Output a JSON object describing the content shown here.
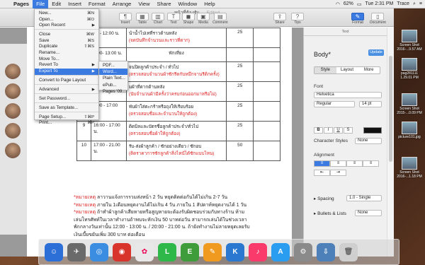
{
  "menubar": {
    "app_name": "Pages",
    "items": [
      "File",
      "Edit",
      "Insert",
      "Format",
      "Arrange",
      "View",
      "Share",
      "Window",
      "Help"
    ],
    "battery": "62%",
    "clock": "Tue 2:31 PM",
    "user": "Trace"
  },
  "window": {
    "title": "หน้าที่ต้องรับ",
    "edited": "— Edited",
    "toolbar": {
      "insert": "Insert",
      "table": "Table",
      "chart": "Chart",
      "text": "Text",
      "shape": "Shape",
      "media": "Media",
      "comment": "Comment",
      "share": "Share",
      "tips": "Tips",
      "format": "Format",
      "document": "Document"
    }
  },
  "file_menu": {
    "items": [
      {
        "label": "New...",
        "shortcut": "⌘N"
      },
      {
        "label": "Open...",
        "shortcut": "⌘O"
      },
      {
        "label": "Open Recent",
        "shortcut": "▶"
      },
      {
        "label": "Close",
        "shortcut": "⌘W"
      },
      {
        "label": "Save",
        "shortcut": "⌘S"
      },
      {
        "label": "Duplicate",
        "shortcut": "⇧⌘S"
      },
      {
        "label": "Rename...",
        "shortcut": ""
      },
      {
        "label": "Move To...",
        "shortcut": ""
      },
      {
        "label": "Revert To",
        "shortcut": "▶"
      },
      {
        "label": "Export To",
        "shortcut": "▶"
      },
      {
        "label": "Convert to Page Layout",
        "shortcut": ""
      },
      {
        "label": "Advanced",
        "shortcut": "▶"
      },
      {
        "label": "Set Password...",
        "shortcut": ""
      },
      {
        "label": "Save as Template...",
        "shortcut": ""
      },
      {
        "label": "Page Setup...",
        "shortcut": "⇧⌘P"
      },
      {
        "label": "Print...",
        "shortcut": "⌘P"
      }
    ]
  },
  "export_submenu": {
    "items": [
      "PDF...",
      "Word...",
      "Plain Text...",
      "ePub...",
      "Pages '09..."
    ]
  },
  "document": {
    "rows": [
      {
        "num": "",
        "time": "00 - 12:00 น.",
        "task": "นำน้ำไปเทที่ราวด้านหลัง",
        "task_red": "(จดบันทึกจำนวนและราวที่ตาก)",
        "pts": "25"
      },
      {
        "num": "",
        "time": "2:00- 13:00 น.",
        "task": "พักเที่ยง",
        "task_red": "",
        "pts": ""
      },
      {
        "num": "",
        "time": "",
        "task": "จนปิดลูกค้าประจำ / ทั่วไป",
        "task_red": "(ตรวจสอบจำนวนผ้าซักรีดกับหมึกจานรีดิกครั้ง)",
        "pts": "25"
      },
      {
        "num": "",
        "time": "",
        "task": "มผ้าที่ตากด้านหลัง",
        "task_red": "(นับจำนวนผ้ามีครั้งว่าครบก่อนออกมาหรือไม่)",
        "pts": "25"
      },
      {
        "num": "",
        "time": "5:00 - 17:00",
        "task": "พับผ้าใส่ตะกร้าหรือถุงให้เรียบร้อย",
        "task_red": "(ตรวจสอบชื่อและจำนวนให้ถูกต้อง)",
        "pts": "25"
      },
      {
        "num": "9",
        "time": "16:00 - 17:00 น.",
        "task": "ติดบิลและบัตรชื่อลูกค้าประจำ/ทั่วไป",
        "task_red": "(ตรวจสอบชื่อผ้าให้ถูกต้อง)",
        "pts": "25"
      },
      {
        "num": "10",
        "time": "17:00 - 21.00 น.",
        "task": "รับ-ส่งผ้าลูกค้า / ซักอย่างเดียว / ซักอบ",
        "task_red": "(ติดราคาการซักลูกค้าสิ่งไหน้ได้ซักแบบไหน)",
        "pts": "50"
      }
    ],
    "notes": [
      {
        "mark": "*หมายเหตุ",
        "text": " ลาวานแจ้งการรวมส่งหน้า 2 วัน หยุดติดต่อกันได้ไม่เกิน 2-7 วัน"
      },
      {
        "mark": "*หมายเหตุ",
        "text": " ภายใน 1เดือนหยุดงานได้ไม่เกิน 4 วัน ภายใน 1 สัปดาห์หยุดงานได้ 1 วัน"
      },
      {
        "mark": "*หมายเหตุ",
        "text": " ถ้าทำผ้าลูกค้าเสียหายหรือสูญหายจะต้องรับผิดชอบร่วมกับทางร้าน ห้าม"
      },
      {
        "mark": "",
        "text": "เล่นโทรศัพท์ในเวลาทำงานถ้าพบจะหักเงิน 50 บาทต่อวัน สามารถเล่นได้ในช่วงเวลา"
      },
      {
        "mark": "",
        "text": "พักกลางวันเท่านั้น 12:00 - 13:00 น. / 20:00 - 21:00 น. ถ้ายังทำงานไม่ลายหยุดเลยรับ"
      },
      {
        "mark": "",
        "text": "เงินเบี้ยขยันเพิ่ม 300 บาท ต่อเดือน"
      }
    ]
  },
  "sidebar": {
    "header": "Text",
    "style_name": "Body*",
    "update": "Update",
    "tabs": [
      "Style",
      "Layout",
      "More"
    ],
    "font_label": "Font",
    "font": "Helvetica",
    "typeface": "Regular",
    "size": "14 pt",
    "char_styles_label": "Character Styles",
    "char_styles_value": "None",
    "alignment_label": "Alignment",
    "spacing_label": "Spacing",
    "spacing_value": "1.0 - Single",
    "bullets_label": "Bullets & Lists",
    "bullets_value": "None"
  },
  "desktop": {
    "icons": [
      "Screen Shot 2016-...9.57 AM",
      "pag281111 1.29.01 PM",
      "Screen Shot 2015-...0.09 PM",
      "picture101.jpg",
      "Screen Shot 2016-...1.18 PM"
    ]
  }
}
